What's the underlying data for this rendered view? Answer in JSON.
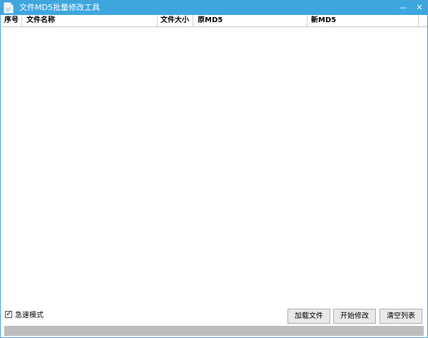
{
  "window": {
    "title": "文件MD5批量修改工具",
    "minimize_glyph": "—",
    "close_glyph": "✕"
  },
  "table": {
    "columns": [
      "序号",
      "文件名称",
      "文件大小",
      "原MD5",
      "新MD5",
      ""
    ],
    "rows": []
  },
  "options": {
    "fast_mode_label": "急速模式",
    "fast_mode_checked": true
  },
  "buttons": {
    "load_label": "加载文件",
    "start_label": "开始修改",
    "clear_label": "清空列表"
  },
  "progress": {
    "fraction": 0
  },
  "colors": {
    "titlebar": "#3ea6df",
    "progress_track": "#bdbdbd"
  },
  "icons": {
    "app": "document-icon",
    "minimize": "minimize-icon",
    "close": "close-icon",
    "checkbox": "checkmark-icon"
  }
}
